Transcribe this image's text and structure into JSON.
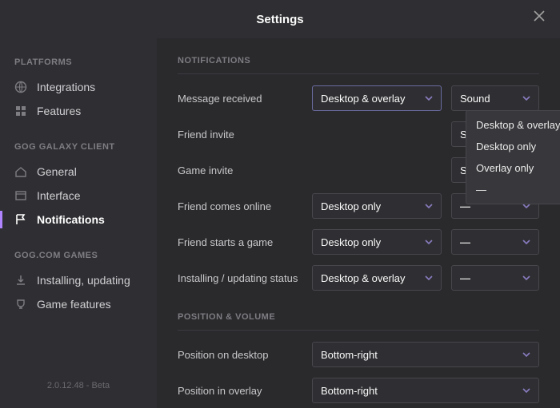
{
  "titlebar": {
    "title": "Settings"
  },
  "sidebar": {
    "groups": [
      {
        "label": "PLATFORMS",
        "items": [
          {
            "label": "Integrations"
          },
          {
            "label": "Features"
          }
        ]
      },
      {
        "label": "GOG GALAXY CLIENT",
        "items": [
          {
            "label": "General"
          },
          {
            "label": "Interface"
          },
          {
            "label": "Notifications"
          }
        ]
      },
      {
        "label": "GOG.COM GAMES",
        "items": [
          {
            "label": "Installing, updating"
          },
          {
            "label": "Game features"
          }
        ]
      }
    ],
    "version": "2.0.12.48 - Beta"
  },
  "content": {
    "notifications_heading": "NOTIFICATIONS",
    "rows": [
      {
        "label": "Message received",
        "display": "Desktop & overlay",
        "sound": "Sound"
      },
      {
        "label": "Friend invite",
        "display": "",
        "sound": "Sound"
      },
      {
        "label": "Game invite",
        "display": "",
        "sound": "Sound"
      },
      {
        "label": "Friend comes online",
        "display": "Desktop only",
        "sound": "—"
      },
      {
        "label": "Friend starts a game",
        "display": "Desktop only",
        "sound": "—"
      },
      {
        "label": "Installing / updating status",
        "display": "Desktop & overlay",
        "sound": "—"
      }
    ],
    "dropdown_options": [
      "Desktop & overlay",
      "Desktop only",
      "Overlay only",
      "—"
    ],
    "position_heading": "POSITION & VOLUME",
    "position_rows": [
      {
        "label": "Position on desktop",
        "value": "Bottom-right"
      },
      {
        "label": "Position in overlay",
        "value": "Bottom-right"
      }
    ]
  }
}
